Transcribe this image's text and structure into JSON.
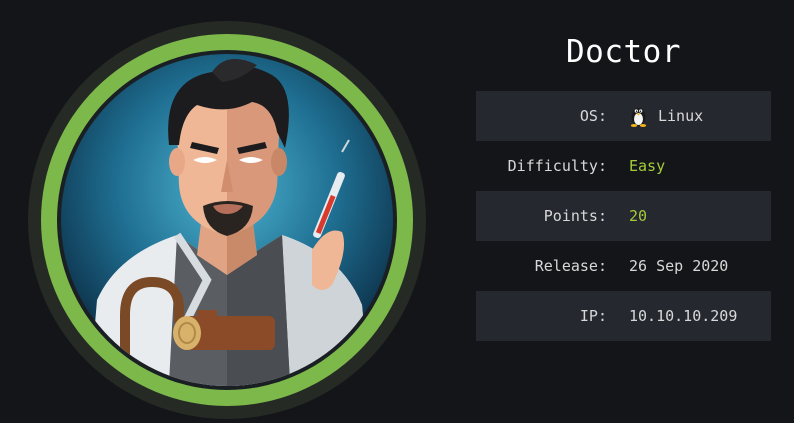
{
  "machine": {
    "name": "Doctor",
    "ring_color": "#7cb84a"
  },
  "info": [
    {
      "label": "OS:",
      "value": "Linux",
      "icon": "linux-tux-icon",
      "accent": false
    },
    {
      "label": "Difficulty:",
      "value": "Easy",
      "accent": true
    },
    {
      "label": "Points:",
      "value": "20",
      "accent": true
    },
    {
      "label": "Release:",
      "value": "26 Sep 2020",
      "accent": false
    },
    {
      "label": "IP:",
      "value": "10.10.10.209",
      "accent": false
    }
  ],
  "colors": {
    "background": "#141519",
    "row_shade": "#262830",
    "accent": "#a4cc3a",
    "ring": "#7cb84a"
  }
}
